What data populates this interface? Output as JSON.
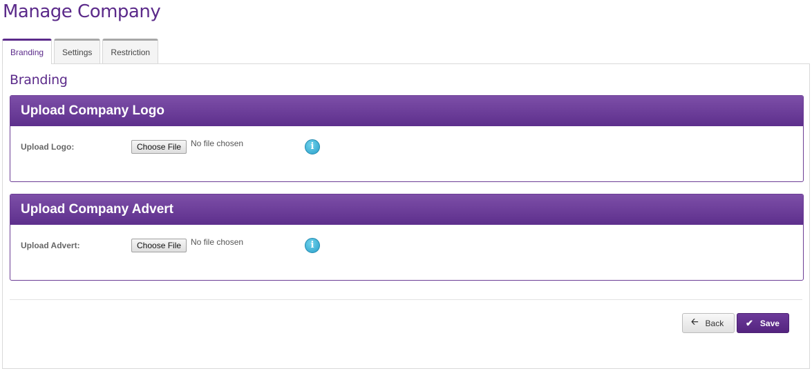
{
  "page": {
    "title": "Manage Company"
  },
  "tabs": [
    {
      "label": "Branding"
    },
    {
      "label": "Settings"
    },
    {
      "label": "Restriction"
    }
  ],
  "branding": {
    "heading": "Branding",
    "logo_panel": {
      "title": "Upload Company Logo",
      "field_label": "Upload Logo:",
      "button_label": "Choose File",
      "status": "No file chosen"
    },
    "advert_panel": {
      "title": "Upload Company Advert",
      "field_label": "Upload Advert:",
      "button_label": "Choose File",
      "status": "No file chosen"
    }
  },
  "actions": {
    "back_label": "Back",
    "save_label": "Save"
  },
  "icons": {
    "info": "info-icon",
    "back": "arrow-left-icon",
    "save": "check-icon"
  },
  "colors": {
    "brand_purple": "#5b2a8a",
    "panel_header": "#6b3b94",
    "info_blue": "#2a9fc9"
  }
}
